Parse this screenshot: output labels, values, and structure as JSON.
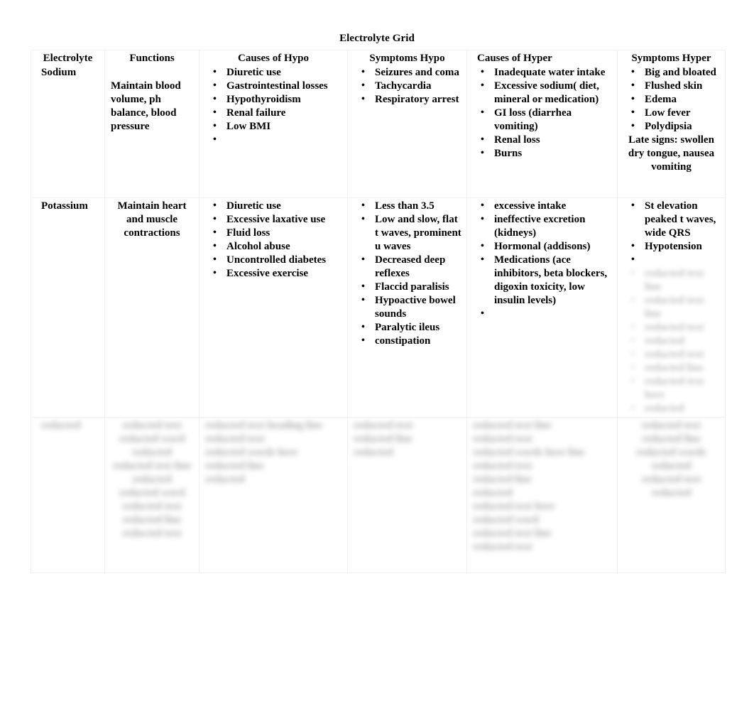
{
  "document": {
    "title": "Electrolyte Grid"
  },
  "table": {
    "headers": [
      "Electrolyte",
      "Functions",
      "Causes of Hypo",
      "Symptoms Hypo",
      "Causes of Hyper",
      "Symptoms Hyper"
    ],
    "rows": [
      {
        "electrolyte": "Sodium",
        "functions": "Maintain blood volume, ph balance, blood pressure",
        "causes_hypo": [
          "Diuretic use",
          "Gastrointestinal losses",
          "Hypothyroidism",
          "Renal failure",
          "Low BMI",
          ""
        ],
        "symptoms_hypo": [
          "Seizures and coma",
          "Tachycardia",
          "Respiratory arrest"
        ],
        "causes_hyper": [
          "Inadequate water intake",
          "Excessive sodium( diet, mineral or medication)",
          "GI loss (diarrhea vomiting)",
          "Renal loss",
          "Burns"
        ],
        "symptoms_hyper": [
          "Big and bloated",
          "Flushed skin",
          "Edema",
          "Low fever",
          "Polydipsia"
        ],
        "symptoms_hyper_note": "Late signs: swollen dry tongue, nausea vomiting"
      },
      {
        "electrolyte": "Potassium",
        "functions": "Maintain heart and muscle contractions",
        "causes_hypo": [
          "Diuretic use",
          "Excessive laxative use",
          "Fluid loss",
          "Alcohol abuse",
          "Uncontrolled diabetes",
          "Excessive exercise"
        ],
        "symptoms_hypo": [
          "Less than 3.5",
          "Low and slow, flat t waves, prominent u waves",
          "Decreased deep reflexes",
          "Flaccid paralisis",
          "Hypoactive bowel sounds",
          "Paralytic ileus",
          "constipation"
        ],
        "causes_hyper": [
          "excessive intake",
          "ineffective excretion (kidneys)",
          "Hormonal (addisons)",
          "Medications (ace inhibitors, beta blockers, digoxin toxicity, low insulin levels)",
          ""
        ],
        "symptoms_hyper": [
          "St elevation peaked t waves, wide QRS",
          "Hypotension",
          ""
        ],
        "symptoms_hyper_redacted": [
          "redacted text line",
          "redacted text line",
          "redacted text",
          "redacted",
          "redacted text",
          "redacted line",
          "redacted text here",
          "redacted",
          "redacted text",
          "redacted"
        ]
      },
      {
        "electrolyte_redacted": "redacted",
        "functions_redacted": [
          "redacted text",
          "redacted word",
          "redacted",
          "redacted text line",
          "redacted",
          "redacted word",
          "redacted text",
          "redacted line",
          "redacted text",
          "redacted"
        ],
        "causes_hypo_redacted": [
          "redacted text heading line",
          "redacted text",
          "redacted words here",
          "redacted line",
          "redacted",
          "redacted"
        ],
        "symptoms_hypo_redacted": [
          "redacted text",
          "redacted line",
          "redacted"
        ],
        "causes_hyper_redacted": [
          "redacted text line",
          "redacted text",
          "redacted words here line",
          "redacted text",
          "redacted line",
          "redacted",
          "redacted text here",
          "redacted word",
          "redacted text line",
          "redacted text",
          "redacted"
        ],
        "symptoms_hyper_redacted": [
          "redacted text",
          "redacted line",
          "redacted words",
          "redacted",
          "redacted text",
          "redacted"
        ]
      }
    ]
  }
}
